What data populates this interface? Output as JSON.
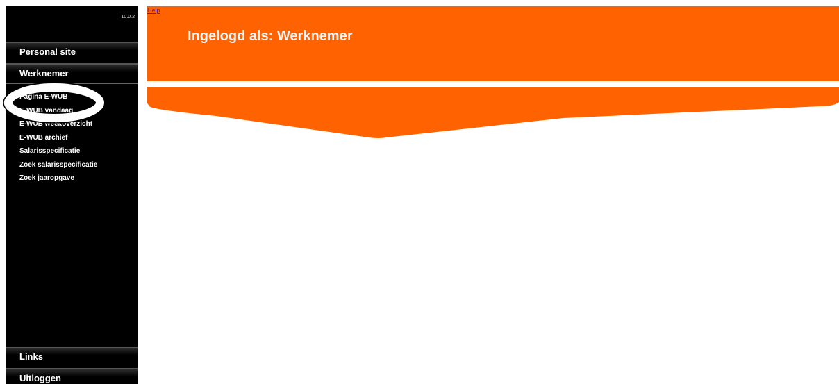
{
  "sidebar": {
    "version": "10.0.2",
    "sections": {
      "personal_site": "Personal site",
      "werknemer": "Werknemer",
      "links": "Links",
      "uitloggen": "Uitloggen"
    },
    "menu_items": [
      "Pagina E-WUB",
      "E-WUB vandaag",
      "E-WUB weekoverzicht",
      "E-WUB archief",
      "Salarisspecificatie",
      "Zoek salarisspecificatie",
      "Zoek jaaropgave"
    ]
  },
  "header": {
    "help_link": "Help",
    "title": "Ingelogd als: Werknemer"
  },
  "colors": {
    "brand_orange": "#ff6200",
    "sidebar_bg": "#000000"
  }
}
